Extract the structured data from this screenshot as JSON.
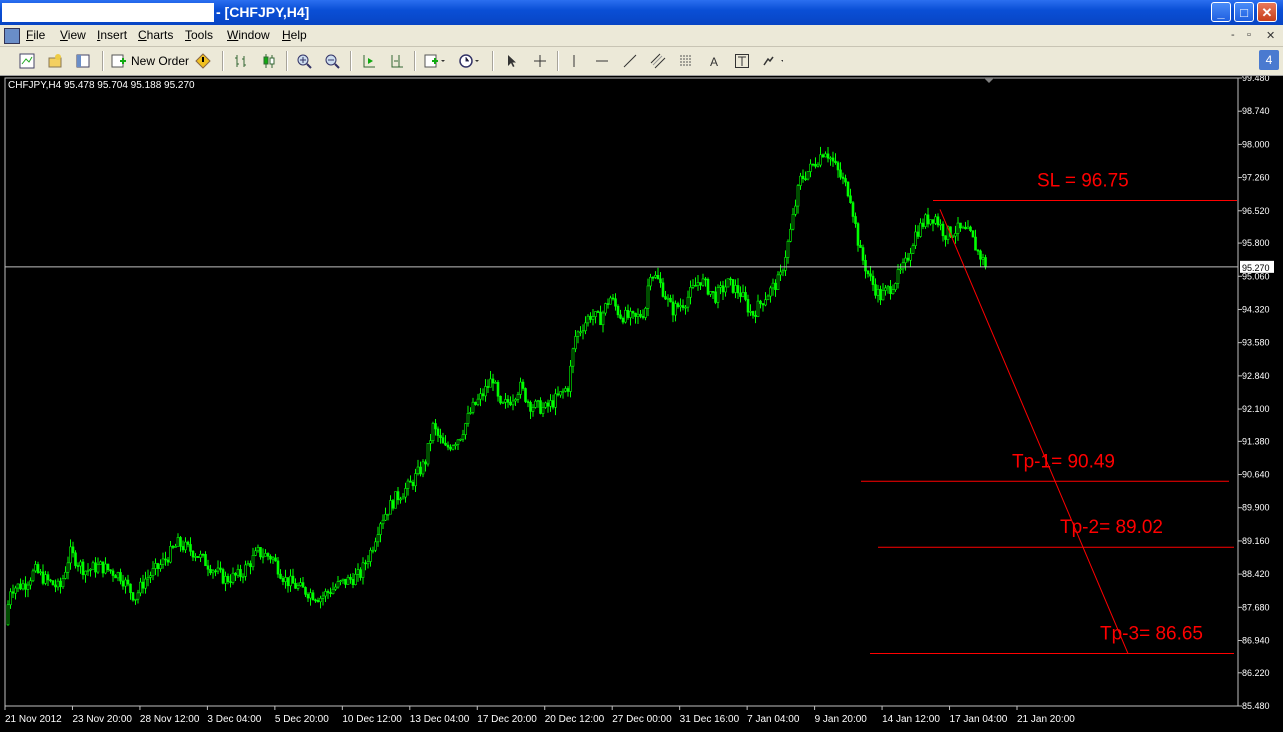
{
  "window": {
    "title": "- [CHFJPY,H4]",
    "minimize": "_",
    "maximize": "□",
    "close": "✕"
  },
  "menu": {
    "items": [
      "File",
      "View",
      "Insert",
      "Charts",
      "Tools",
      "Window",
      "Help"
    ],
    "mdi_controls": [
      "-",
      "▫",
      "✕"
    ]
  },
  "toolbar": {
    "new_order_label": "New Order",
    "badge": "4",
    "icons": [
      "new-chart-icon",
      "profiles-icon",
      "market-watch-icon",
      "new-order-icon",
      "expert-advisor-icon",
      "bar-chart-icon",
      "candlestick-icon",
      "zoom-in-icon",
      "zoom-out-icon",
      "auto-scroll-icon",
      "chart-shift-icon",
      "indicators-icon",
      "periods-icon",
      "cursor-icon",
      "crosshair-icon",
      "vertical-line-icon",
      "horizontal-line-icon",
      "trendline-icon",
      "channel-icon",
      "fibonacci-icon",
      "text-icon",
      "text-label-icon",
      "arrows-icon"
    ]
  },
  "chart": {
    "symbol_info": "CHFJPY,H4  95.478 95.704 95.188 95.270",
    "current_price_label": "95.270",
    "current_price": 95.27,
    "candle_color": "#00ff00",
    "line_color": "#ff0000",
    "annotations": [
      {
        "label": "SL = 96.75",
        "price": 96.75
      },
      {
        "label": "Tp-1= 90.49",
        "price": 90.49
      },
      {
        "label": "Tp-2= 89.02",
        "price": 89.02
      },
      {
        "label": "Tp-3= 86.65",
        "price": 86.65
      }
    ],
    "y_ticks": [
      "99.480",
      "98.740",
      "98.000",
      "97.260",
      "96.520",
      "95.800",
      "95.060",
      "94.320",
      "93.580",
      "92.840",
      "92.100",
      "91.380",
      "90.640",
      "89.900",
      "89.160",
      "88.420",
      "87.680",
      "86.940",
      "86.220",
      "85.480"
    ],
    "x_ticks": [
      "21 Nov 2012",
      "23 Nov 20:00",
      "28 Nov 12:00",
      "3 Dec 04:00",
      "5 Dec 20:00",
      "10 Dec 12:00",
      "13 Dec 04:00",
      "17 Dec 20:00",
      "20 Dec 12:00",
      "27 Dec 00:00",
      "31 Dec 16:00",
      "7 Jan 04:00",
      "9 Jan 20:00",
      "14 Jan 12:00",
      "17 Jan 04:00",
      "21 Jan 20:00"
    ]
  },
  "chart_data": {
    "type": "candlestick",
    "title": "CHFJPY,H4",
    "ylim": [
      85.48,
      99.48
    ],
    "path": [
      [
        0,
        86.3
      ],
      [
        10,
        88.1
      ],
      [
        25,
        88.2
      ],
      [
        35,
        88.5
      ],
      [
        45,
        88.3
      ],
      [
        60,
        88.1
      ],
      [
        70,
        88.9
      ],
      [
        85,
        88.5
      ],
      [
        100,
        88.6
      ],
      [
        120,
        88.4
      ],
      [
        135,
        87.9
      ],
      [
        145,
        88.3
      ],
      [
        160,
        88.6
      ],
      [
        178,
        89.1
      ],
      [
        195,
        88.9
      ],
      [
        210,
        88.6
      ],
      [
        225,
        88.3
      ],
      [
        240,
        88.4
      ],
      [
        258,
        88.9
      ],
      [
        272,
        88.8
      ],
      [
        285,
        88.3
      ],
      [
        300,
        88.1
      ],
      [
        320,
        87.9
      ],
      [
        340,
        88.2
      ],
      [
        360,
        88.4
      ],
      [
        372,
        89.0
      ],
      [
        380,
        89.6
      ],
      [
        395,
        90.1
      ],
      [
        410,
        90.4
      ],
      [
        425,
        90.9
      ],
      [
        433,
        91.7
      ],
      [
        445,
        91.2
      ],
      [
        460,
        91.5
      ],
      [
        472,
        92.1
      ],
      [
        482,
        92.4
      ],
      [
        493,
        92.8
      ],
      [
        500,
        92.1
      ],
      [
        510,
        92.3
      ],
      [
        520,
        92.6
      ],
      [
        530,
        92.2
      ],
      [
        545,
        92.1
      ],
      [
        560,
        92.4
      ],
      [
        568,
        92.6
      ],
      [
        575,
        93.7
      ],
      [
        590,
        94.2
      ],
      [
        600,
        94.1
      ],
      [
        610,
        94.6
      ],
      [
        620,
        94.2
      ],
      [
        635,
        94.1
      ],
      [
        645,
        94.3
      ],
      [
        650,
        95.2
      ],
      [
        660,
        94.9
      ],
      [
        672,
        94.3
      ],
      [
        685,
        94.5
      ],
      [
        700,
        95.0
      ],
      [
        715,
        94.6
      ],
      [
        728,
        94.9
      ],
      [
        740,
        94.7
      ],
      [
        752,
        94.2
      ],
      [
        765,
        94.6
      ],
      [
        780,
        95.0
      ],
      [
        790,
        96.0
      ],
      [
        800,
        97.2
      ],
      [
        812,
        97.5
      ],
      [
        825,
        97.9
      ],
      [
        833,
        97.6
      ],
      [
        840,
        97.3
      ],
      [
        850,
        96.9
      ],
      [
        860,
        95.6
      ],
      [
        870,
        95.0
      ],
      [
        880,
        94.6
      ],
      [
        890,
        94.8
      ],
      [
        905,
        95.3
      ],
      [
        915,
        96.0
      ],
      [
        925,
        96.3
      ],
      [
        935,
        96.4
      ],
      [
        945,
        96.0
      ],
      [
        958,
        96.1
      ],
      [
        970,
        96.0
      ],
      [
        978,
        95.6
      ],
      [
        987,
        95.27
      ]
    ]
  }
}
